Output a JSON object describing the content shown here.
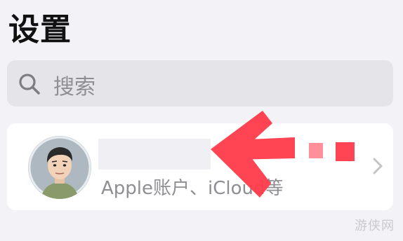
{
  "header": {
    "title": "设置"
  },
  "search": {
    "placeholder": "搜索",
    "icon": "search-icon"
  },
  "account": {
    "subtitle": "Apple账户、iCloud等",
    "avatar_icon": "avatar",
    "chevron_icon": "chevron-right-icon"
  },
  "annotation": {
    "arrow_color": "#ff3b4a",
    "arrow_icon": "red-arrow-left-icon"
  },
  "watermark": {
    "text": "游侠网"
  }
}
